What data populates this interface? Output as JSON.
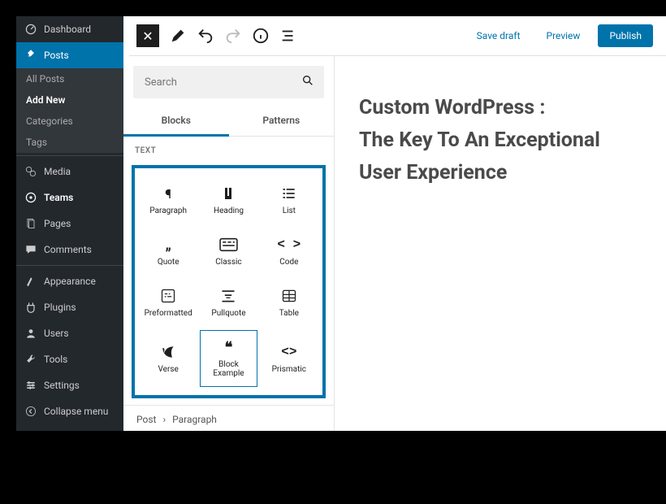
{
  "sidebar": {
    "dashboard": "Dashboard",
    "posts": "Posts",
    "sub": {
      "all": "All Posts",
      "add": "Add New",
      "cats": "Categories",
      "tags": "Tags"
    },
    "media": "Media",
    "teams": "Teams",
    "pages": "Pages",
    "comments": "Comments",
    "appearance": "Appearance",
    "plugins": "Plugins",
    "users": "Users",
    "tools": "Tools",
    "settings": "Settings",
    "collapse": "Collapse menu"
  },
  "toolbar": {
    "save": "Save draft",
    "preview": "Preview",
    "publish": "Publish"
  },
  "inserter": {
    "search_placeholder": "Search",
    "tabs": {
      "blocks": "Blocks",
      "patterns": "Patterns"
    },
    "section": "TEXT",
    "blocks": {
      "paragraph": "Paragraph",
      "heading": "Heading",
      "list": "List",
      "quote": "Quote",
      "classic": "Classic",
      "code": "Code",
      "preformatted": "Preformatted",
      "pullquote": "Pullquote",
      "table": "Table",
      "verse": "Verse",
      "block_example": "Block Example",
      "prismatic": "Prismatic"
    },
    "crumbs": {
      "post": "Post",
      "paragraph": "Paragraph"
    }
  },
  "article": {
    "line1": "Custom WordPress :",
    "line2": "The Key To An Exceptional",
    "line3": "User Experience"
  }
}
